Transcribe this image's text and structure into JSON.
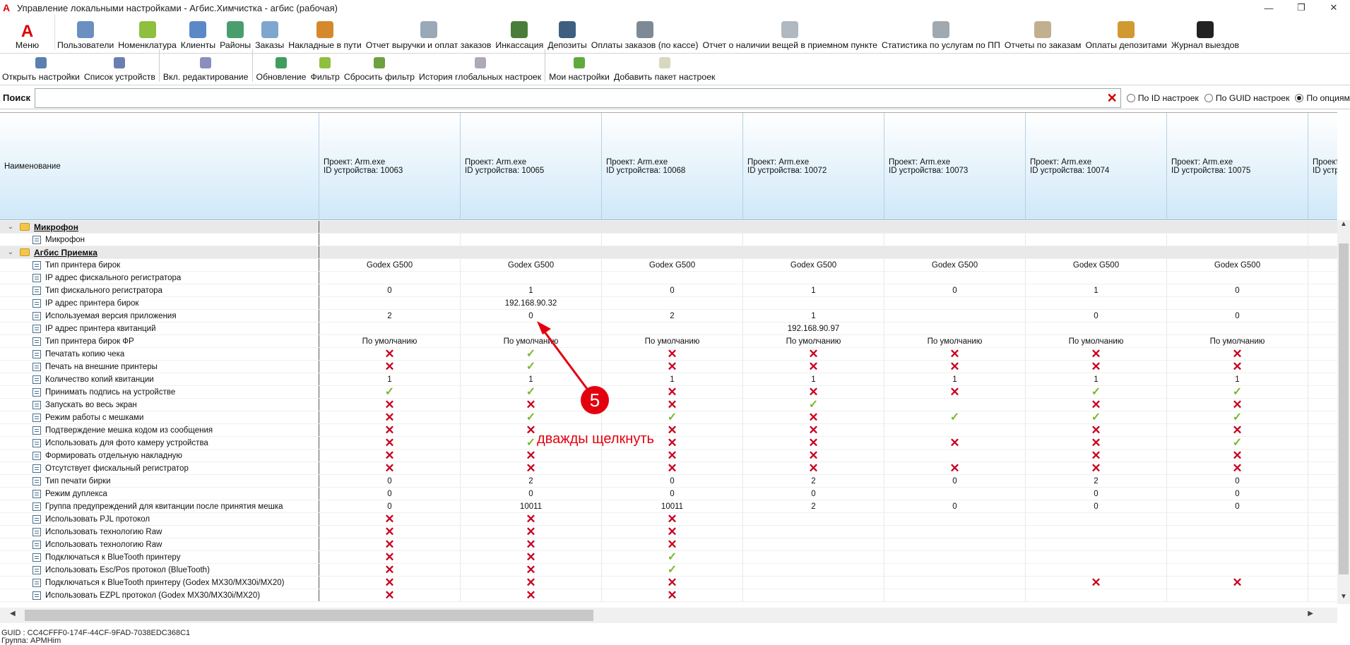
{
  "window": {
    "title": "Управление локальными настройками - Агбис.Химчистка - агбис (рабочая)",
    "controls": [
      "—",
      "❐",
      "✕"
    ]
  },
  "ribbon1": {
    "menu_label": "Меню",
    "items": [
      "Пользователи",
      "Номенклатура",
      "Клиенты",
      "Районы",
      "Заказы",
      "Накладные в пути",
      "Отчет выручки и оплат заказов",
      "Инкассация",
      "Депозиты",
      "Оплаты заказов (по кассе)",
      "Отчет о наличии вещей в приемном пункте",
      "Статистика по услугам по ПП",
      "Отчеты по заказам",
      "Оплаты депозитами",
      "Журнал выездов"
    ]
  },
  "ribbon2": {
    "items": [
      "Открыть настройки",
      "Список устройств",
      "Вкл. редактирование",
      "Обновление",
      "Фильтр",
      "Сбросить фильтр",
      "История глобальных настроек",
      "Мои настройки",
      "Добавить пакет настроек"
    ]
  },
  "search": {
    "label": "Поиск",
    "value": "",
    "radios": [
      {
        "label": "По ID настроек",
        "checked": false
      },
      {
        "label": "По GUID настроек",
        "checked": false
      },
      {
        "label": "По опциям",
        "checked": true
      }
    ]
  },
  "grid": {
    "name_header": "Наименование",
    "devices": [
      {
        "project": "Проект: Arm.exe",
        "device": "ID устройства: 10063"
      },
      {
        "project": "Проект: Arm.exe",
        "device": "ID устройства: 10065"
      },
      {
        "project": "Проект: Arm.exe",
        "device": "ID устройства: 10068"
      },
      {
        "project": "Проект: Arm.exe",
        "device": "ID устройства: 10072"
      },
      {
        "project": "Проект: Arm.exe",
        "device": "ID устройства: 10073"
      },
      {
        "project": "Проект: Arm.exe",
        "device": "ID устройства: 10074"
      },
      {
        "project": "Проект: Arm.exe",
        "device": "ID устройства: 10075"
      },
      {
        "project": "Проект: Arm.exe",
        "device": "ID устройства:"
      }
    ],
    "rows": [
      {
        "type": "group",
        "name": "Микрофон",
        "v": [
          "",
          "",
          "",
          "",
          "",
          "",
          "",
          ""
        ]
      },
      {
        "type": "item",
        "name": "Микрофон",
        "v": [
          "",
          "",
          "",
          "",
          "",
          "",
          "",
          ""
        ]
      },
      {
        "type": "group",
        "name": "Агбис Приемка",
        "v": [
          "",
          "",
          "",
          "",
          "",
          "",
          "",
          ""
        ]
      },
      {
        "type": "item",
        "name": "Тип принтера бирок",
        "v": [
          "Godex G500",
          "Godex G500",
          "Godex G500",
          "Godex G500",
          "Godex G500",
          "Godex G500",
          "Godex G500",
          ""
        ]
      },
      {
        "type": "item",
        "name": "IP адрес фискального регистратора",
        "v": [
          "",
          "",
          "",
          "",
          "",
          "",
          "",
          ""
        ]
      },
      {
        "type": "item",
        "name": "Тип фискального регистратора",
        "v": [
          "0",
          "1",
          "0",
          "1",
          "0",
          "1",
          "0",
          ""
        ]
      },
      {
        "type": "item",
        "name": "IP адрес принтера бирок",
        "v": [
          "",
          "192.168.90.32",
          "",
          "",
          "",
          "",
          "",
          ""
        ]
      },
      {
        "type": "item",
        "name": "Используемая версия приложения",
        "v": [
          "2",
          "0",
          "2",
          "1",
          "",
          "0",
          "0",
          ""
        ]
      },
      {
        "type": "item",
        "name": "IP адрес принтера квитанций",
        "v": [
          "",
          "",
          "",
          "192.168.90.97",
          "",
          "",
          "",
          ""
        ]
      },
      {
        "type": "item",
        "name": "Тип принтера бирок ФР",
        "v": [
          "По умолчанию",
          "По умолчанию",
          "По умолчанию",
          "По умолчанию",
          "По умолчанию",
          "По умолчанию",
          "По умолчанию",
          ""
        ]
      },
      {
        "type": "item",
        "name": "Печатать копию чека",
        "v": [
          "no",
          "ok",
          "no",
          "no",
          "no",
          "no",
          "no",
          ""
        ]
      },
      {
        "type": "item",
        "name": "Печать на внешние принтеры",
        "v": [
          "no",
          "ok",
          "no",
          "no",
          "no",
          "no",
          "no",
          ""
        ]
      },
      {
        "type": "item",
        "name": "Количество копий квитанции",
        "v": [
          "1",
          "1",
          "1",
          "1",
          "1",
          "1",
          "1",
          ""
        ]
      },
      {
        "type": "item",
        "name": "Принимать подпись на устройстве",
        "v": [
          "ok",
          "ok",
          "no",
          "no",
          "no",
          "ok",
          "ok",
          ""
        ]
      },
      {
        "type": "item",
        "name": "Запускать во весь экран",
        "v": [
          "no",
          "no",
          "no",
          "ok",
          "",
          "no",
          "no",
          ""
        ]
      },
      {
        "type": "item",
        "name": "Режим работы с мешками",
        "v": [
          "no",
          "ok",
          "ok",
          "no",
          "ok",
          "ok",
          "ok",
          ""
        ]
      },
      {
        "type": "item",
        "name": "Подтверждение мешка кодом из сообщения",
        "v": [
          "no",
          "no",
          "no",
          "no",
          "",
          "no",
          "no",
          ""
        ]
      },
      {
        "type": "item",
        "name": "Использовать для фото камеру устройства",
        "v": [
          "no",
          "ok",
          "no",
          "no",
          "no",
          "no",
          "ok",
          ""
        ]
      },
      {
        "type": "item",
        "name": "Формировать отдельную накладную",
        "v": [
          "no",
          "no",
          "no",
          "no",
          "",
          "no",
          "no",
          ""
        ]
      },
      {
        "type": "item",
        "name": "Отсутствует фискальный регистратор",
        "v": [
          "no",
          "no",
          "no",
          "no",
          "no",
          "no",
          "no",
          ""
        ]
      },
      {
        "type": "item",
        "name": "Тип печати бирки",
        "v": [
          "0",
          "2",
          "0",
          "2",
          "0",
          "2",
          "0",
          ""
        ]
      },
      {
        "type": "item",
        "name": "Режим дуплекса",
        "v": [
          "0",
          "0",
          "0",
          "0",
          "",
          "0",
          "0",
          ""
        ]
      },
      {
        "type": "item",
        "name": "Группа предупреждений для квитанции после принятия мешка",
        "v": [
          "0",
          "10011",
          "10011",
          "2",
          "0",
          "0",
          "0",
          ""
        ]
      },
      {
        "type": "item",
        "name": "Использовать PJL протокол",
        "v": [
          "no",
          "no",
          "no",
          "",
          "",
          "",
          "",
          ""
        ]
      },
      {
        "type": "item",
        "name": "Использовать технологию Raw",
        "v": [
          "no",
          "no",
          "no",
          "",
          "",
          "",
          "",
          ""
        ]
      },
      {
        "type": "item",
        "name": "Использовать технологию Raw",
        "v": [
          "no",
          "no",
          "no",
          "",
          "",
          "",
          "",
          ""
        ]
      },
      {
        "type": "item",
        "name": "Подключаться к BlueTooth принтеру",
        "v": [
          "no",
          "no",
          "ok",
          "",
          "",
          "",
          "",
          ""
        ]
      },
      {
        "type": "item",
        "name": "Использовать Esc/Pos протокол (BlueTooth)",
        "v": [
          "no",
          "no",
          "ok",
          "",
          "",
          "",
          "",
          ""
        ]
      },
      {
        "type": "item",
        "name": "Подключаться к BlueTooth принтеру (Godex MX30/MX30i/MX20)",
        "v": [
          "no",
          "no",
          "no",
          "",
          "",
          "no",
          "no",
          ""
        ]
      },
      {
        "type": "item",
        "name": "Использовать EZPL протокол (Godex MX30/MX30i/MX20)",
        "v": [
          "no",
          "no",
          "no",
          "",
          "",
          "",
          "",
          ""
        ]
      }
    ]
  },
  "status": {
    "guid": "GUID : CC4CFFF0-174F-44CF-9FAD-7038EDC368C1",
    "group": "Группа: АРМHim"
  },
  "annotation": {
    "number": "5",
    "text": "дважды щелкнуть",
    "color": "#e3000f"
  }
}
